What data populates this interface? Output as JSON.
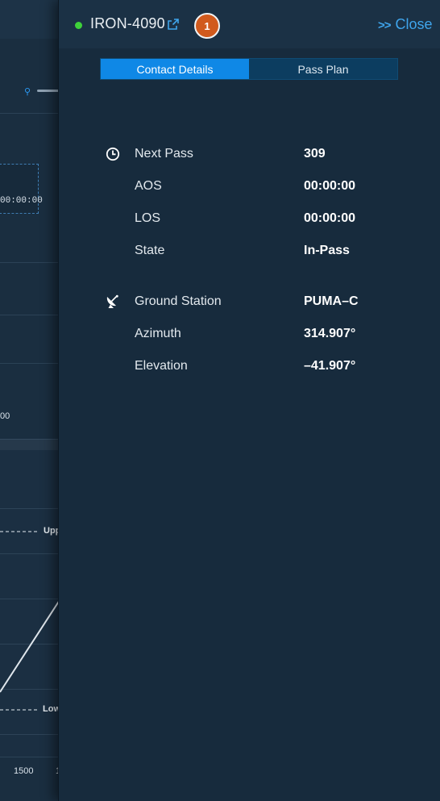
{
  "background": {
    "time_readout": "00:00:00",
    "tick_label": "00",
    "upper_label": "Upp",
    "lower_label": "Low",
    "axis_ticks": [
      "1500",
      "1"
    ]
  },
  "panel": {
    "satellite_name": "IRON-4090",
    "status_color": "#3ed13a",
    "badge_count": "1",
    "close_label": "Close",
    "close_icon": "double-chevron-right-icon",
    "tabs": [
      {
        "label": "Contact Details",
        "active": true
      },
      {
        "label": "Pass Plan",
        "active": false
      }
    ],
    "pass": {
      "icon": "clock-icon",
      "items": [
        {
          "label": "Next Pass",
          "value": "309"
        },
        {
          "label": "AOS",
          "value": "00:00:00"
        },
        {
          "label": "LOS",
          "value": "00:00:00"
        },
        {
          "label": "State",
          "value": "In-Pass"
        }
      ]
    },
    "ground": {
      "icon": "satellite-dish-icon",
      "items": [
        {
          "label": "Ground Station",
          "value": "PUMA–C"
        },
        {
          "label": "Azimuth",
          "value": "314.907°"
        },
        {
          "label": "Elevation",
          "value": "–41.907°"
        }
      ]
    }
  }
}
